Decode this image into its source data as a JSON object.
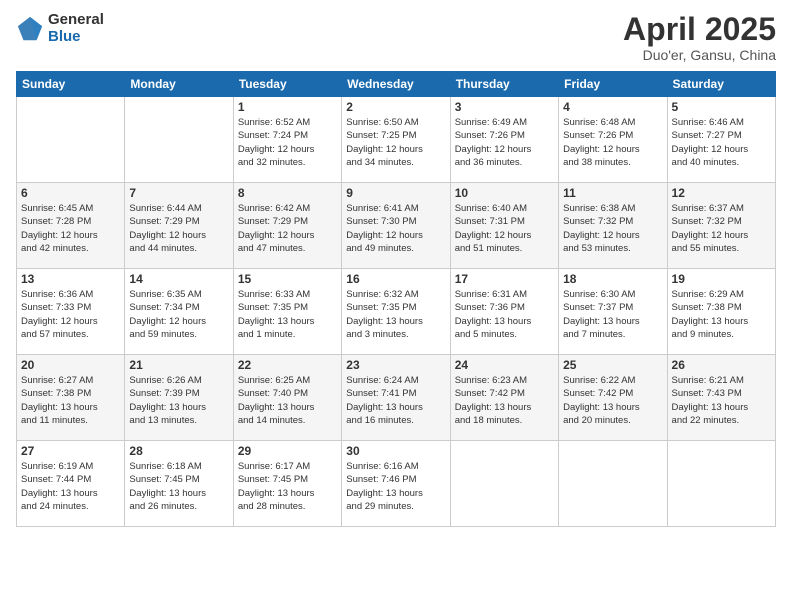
{
  "logo": {
    "general": "General",
    "blue": "Blue"
  },
  "title": "April 2025",
  "subtitle": "Duo'er, Gansu, China",
  "weekdays": [
    "Sunday",
    "Monday",
    "Tuesday",
    "Wednesday",
    "Thursday",
    "Friday",
    "Saturday"
  ],
  "weeks": [
    [
      {
        "num": "",
        "info": ""
      },
      {
        "num": "",
        "info": ""
      },
      {
        "num": "1",
        "info": "Sunrise: 6:52 AM\nSunset: 7:24 PM\nDaylight: 12 hours\nand 32 minutes."
      },
      {
        "num": "2",
        "info": "Sunrise: 6:50 AM\nSunset: 7:25 PM\nDaylight: 12 hours\nand 34 minutes."
      },
      {
        "num": "3",
        "info": "Sunrise: 6:49 AM\nSunset: 7:26 PM\nDaylight: 12 hours\nand 36 minutes."
      },
      {
        "num": "4",
        "info": "Sunrise: 6:48 AM\nSunset: 7:26 PM\nDaylight: 12 hours\nand 38 minutes."
      },
      {
        "num": "5",
        "info": "Sunrise: 6:46 AM\nSunset: 7:27 PM\nDaylight: 12 hours\nand 40 minutes."
      }
    ],
    [
      {
        "num": "6",
        "info": "Sunrise: 6:45 AM\nSunset: 7:28 PM\nDaylight: 12 hours\nand 42 minutes."
      },
      {
        "num": "7",
        "info": "Sunrise: 6:44 AM\nSunset: 7:29 PM\nDaylight: 12 hours\nand 44 minutes."
      },
      {
        "num": "8",
        "info": "Sunrise: 6:42 AM\nSunset: 7:29 PM\nDaylight: 12 hours\nand 47 minutes."
      },
      {
        "num": "9",
        "info": "Sunrise: 6:41 AM\nSunset: 7:30 PM\nDaylight: 12 hours\nand 49 minutes."
      },
      {
        "num": "10",
        "info": "Sunrise: 6:40 AM\nSunset: 7:31 PM\nDaylight: 12 hours\nand 51 minutes."
      },
      {
        "num": "11",
        "info": "Sunrise: 6:38 AM\nSunset: 7:32 PM\nDaylight: 12 hours\nand 53 minutes."
      },
      {
        "num": "12",
        "info": "Sunrise: 6:37 AM\nSunset: 7:32 PM\nDaylight: 12 hours\nand 55 minutes."
      }
    ],
    [
      {
        "num": "13",
        "info": "Sunrise: 6:36 AM\nSunset: 7:33 PM\nDaylight: 12 hours\nand 57 minutes."
      },
      {
        "num": "14",
        "info": "Sunrise: 6:35 AM\nSunset: 7:34 PM\nDaylight: 12 hours\nand 59 minutes."
      },
      {
        "num": "15",
        "info": "Sunrise: 6:33 AM\nSunset: 7:35 PM\nDaylight: 13 hours\nand 1 minute."
      },
      {
        "num": "16",
        "info": "Sunrise: 6:32 AM\nSunset: 7:35 PM\nDaylight: 13 hours\nand 3 minutes."
      },
      {
        "num": "17",
        "info": "Sunrise: 6:31 AM\nSunset: 7:36 PM\nDaylight: 13 hours\nand 5 minutes."
      },
      {
        "num": "18",
        "info": "Sunrise: 6:30 AM\nSunset: 7:37 PM\nDaylight: 13 hours\nand 7 minutes."
      },
      {
        "num": "19",
        "info": "Sunrise: 6:29 AM\nSunset: 7:38 PM\nDaylight: 13 hours\nand 9 minutes."
      }
    ],
    [
      {
        "num": "20",
        "info": "Sunrise: 6:27 AM\nSunset: 7:38 PM\nDaylight: 13 hours\nand 11 minutes."
      },
      {
        "num": "21",
        "info": "Sunrise: 6:26 AM\nSunset: 7:39 PM\nDaylight: 13 hours\nand 13 minutes."
      },
      {
        "num": "22",
        "info": "Sunrise: 6:25 AM\nSunset: 7:40 PM\nDaylight: 13 hours\nand 14 minutes."
      },
      {
        "num": "23",
        "info": "Sunrise: 6:24 AM\nSunset: 7:41 PM\nDaylight: 13 hours\nand 16 minutes."
      },
      {
        "num": "24",
        "info": "Sunrise: 6:23 AM\nSunset: 7:42 PM\nDaylight: 13 hours\nand 18 minutes."
      },
      {
        "num": "25",
        "info": "Sunrise: 6:22 AM\nSunset: 7:42 PM\nDaylight: 13 hours\nand 20 minutes."
      },
      {
        "num": "26",
        "info": "Sunrise: 6:21 AM\nSunset: 7:43 PM\nDaylight: 13 hours\nand 22 minutes."
      }
    ],
    [
      {
        "num": "27",
        "info": "Sunrise: 6:19 AM\nSunset: 7:44 PM\nDaylight: 13 hours\nand 24 minutes."
      },
      {
        "num": "28",
        "info": "Sunrise: 6:18 AM\nSunset: 7:45 PM\nDaylight: 13 hours\nand 26 minutes."
      },
      {
        "num": "29",
        "info": "Sunrise: 6:17 AM\nSunset: 7:45 PM\nDaylight: 13 hours\nand 28 minutes."
      },
      {
        "num": "30",
        "info": "Sunrise: 6:16 AM\nSunset: 7:46 PM\nDaylight: 13 hours\nand 29 minutes."
      },
      {
        "num": "",
        "info": ""
      },
      {
        "num": "",
        "info": ""
      },
      {
        "num": "",
        "info": ""
      }
    ]
  ]
}
